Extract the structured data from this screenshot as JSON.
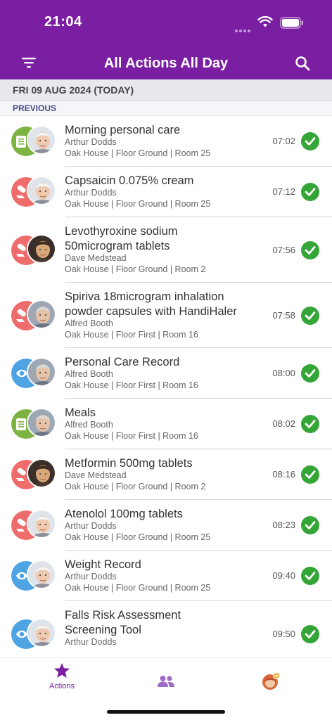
{
  "status_bar": {
    "time": "21:04"
  },
  "header": {
    "title": "All Actions All Day"
  },
  "date_bar": {
    "label": "FRI 09 AUG 2024 (TODAY)"
  },
  "section": {
    "label": "PREVIOUS"
  },
  "colors": {
    "brand": "#7b1fa2",
    "care": "#7cb342",
    "medication": "#ef6c6c",
    "observation": "#4ea3e3",
    "done": "#34a537"
  },
  "actions": [
    {
      "title_lines": [
        "Morning personal care"
      ],
      "person": "Arthur Dodds",
      "location": "Oak House | Floor Ground | Room 25",
      "time": "07:02",
      "type_icon": "clipboard-icon",
      "type_color": "#7cb342",
      "avatar": "arthur"
    },
    {
      "title_lines": [
        "Capsaicin 0.075% cream"
      ],
      "person": "Arthur Dodds",
      "location": "Oak House | Floor Ground | Room 25",
      "time": "07:12",
      "type_icon": "pill-icon",
      "type_color": "#ef6c6c",
      "avatar": "arthur"
    },
    {
      "title_lines": [
        "Levothyroxine sodium",
        "50microgram tablets"
      ],
      "person": "Dave Medstead",
      "location": "Oak House | Floor Ground | Room 2",
      "time": "07:56",
      "type_icon": "pill-icon",
      "type_color": "#ef6c6c",
      "avatar": "dave"
    },
    {
      "title_lines": [
        "Spiriva 18microgram inhalation",
        "powder capsules with HandiHaler"
      ],
      "person": "Alfred Booth",
      "location": "Oak House | Floor First | Room 16",
      "time": "07:58",
      "type_icon": "pill-icon",
      "type_color": "#ef6c6c",
      "avatar": "alfred"
    },
    {
      "title_lines": [
        "Personal Care Record"
      ],
      "person": "Alfred Booth",
      "location": "Oak House | Floor First | Room 16",
      "time": "08:00",
      "type_icon": "eye-icon",
      "type_color": "#4ea3e3",
      "avatar": "alfred"
    },
    {
      "title_lines": [
        "Meals"
      ],
      "person": "Alfred Booth",
      "location": "Oak House | Floor First | Room 16",
      "time": "08:02",
      "type_icon": "clipboard-icon",
      "type_color": "#7cb342",
      "avatar": "alfred"
    },
    {
      "title_lines": [
        "Metformin 500mg tablets"
      ],
      "person": "Dave Medstead",
      "location": "Oak House | Floor Ground | Room 2",
      "time": "08:16",
      "type_icon": "pill-icon",
      "type_color": "#ef6c6c",
      "avatar": "dave"
    },
    {
      "title_lines": [
        "Atenolol 100mg tablets"
      ],
      "person": "Arthur Dodds",
      "location": "Oak House | Floor Ground | Room 25",
      "time": "08:23",
      "type_icon": "pill-icon",
      "type_color": "#ef6c6c",
      "avatar": "arthur"
    },
    {
      "title_lines": [
        "Weight Record"
      ],
      "person": "Arthur Dodds",
      "location": "Oak House | Floor Ground | Room 25",
      "time": "09:40",
      "type_icon": "eye-icon",
      "type_color": "#4ea3e3",
      "avatar": "arthur"
    },
    {
      "title_lines": [
        "Falls Risk Assessment",
        "Screening Tool"
      ],
      "person": "Arthur Dodds",
      "location": "",
      "time": "09:50",
      "type_icon": "eye-icon",
      "type_color": "#4ea3e3",
      "avatar": "arthur"
    }
  ],
  "tabbar": {
    "actions_label": "Actions",
    "tabs": [
      {
        "name": "tab-actions",
        "icon": "star-icon",
        "active": true
      },
      {
        "name": "tab-residents",
        "icon": "people-icon",
        "active": false
      },
      {
        "name": "tab-profile",
        "icon": "avatar",
        "active": false
      }
    ]
  }
}
